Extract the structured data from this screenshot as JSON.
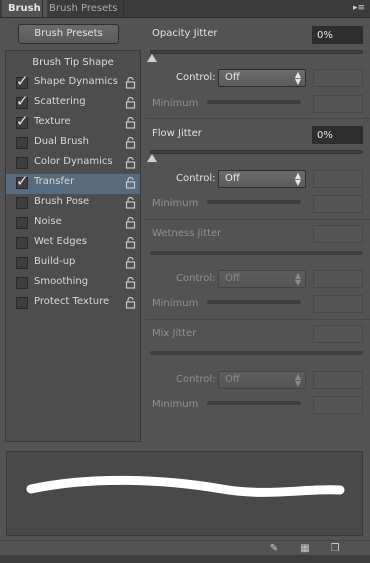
{
  "tabs": [
    {
      "label": "Brush"
    },
    {
      "label": "Brush Presets"
    }
  ],
  "presets_button": "Brush Presets",
  "sidebar": {
    "tip_shape": "Brush Tip Shape",
    "items": [
      {
        "label": "Shape Dynamics",
        "checked": true
      },
      {
        "label": "Scattering",
        "checked": true
      },
      {
        "label": "Texture",
        "checked": true
      },
      {
        "label": "Dual Brush",
        "checked": false
      },
      {
        "label": "Color Dynamics",
        "checked": false
      },
      {
        "label": "Transfer",
        "checked": true,
        "selected": true
      },
      {
        "label": "Brush Pose",
        "checked": false
      },
      {
        "label": "Noise",
        "checked": false
      },
      {
        "label": "Wet Edges",
        "checked": false
      },
      {
        "label": "Build-up",
        "checked": false
      },
      {
        "label": "Smoothing",
        "checked": false
      },
      {
        "label": "Protect Texture",
        "checked": false
      }
    ]
  },
  "opacity_jitter": {
    "label": "Opacity Jitter",
    "value": "0%",
    "control_label": "Control:",
    "control_value": "Off",
    "minimum_label": "Minimum"
  },
  "flow_jitter": {
    "label": "Flow Jitter",
    "value": "0%",
    "control_label": "Control:",
    "control_value": "Off",
    "minimum_label": "Minimum"
  },
  "wetness_jitter": {
    "label": "Wetness Jitter",
    "control_label": "Control:",
    "control_value": "Off",
    "minimum_label": "Minimum"
  },
  "mix_jitter": {
    "label": "Mix Jitter",
    "control_label": "Control:",
    "control_value": "Off",
    "minimum_label": "Minimum"
  },
  "icons": {
    "panel_menu": "menu-icon",
    "toggle_preview": "brush-toggle-icon",
    "grid": "grid-icon",
    "new_preset": "new-preset-icon"
  },
  "colors": {
    "panel_bg": "#535353",
    "selected_row": "#5a6a7d",
    "field_bg": "#3c3c3c"
  }
}
